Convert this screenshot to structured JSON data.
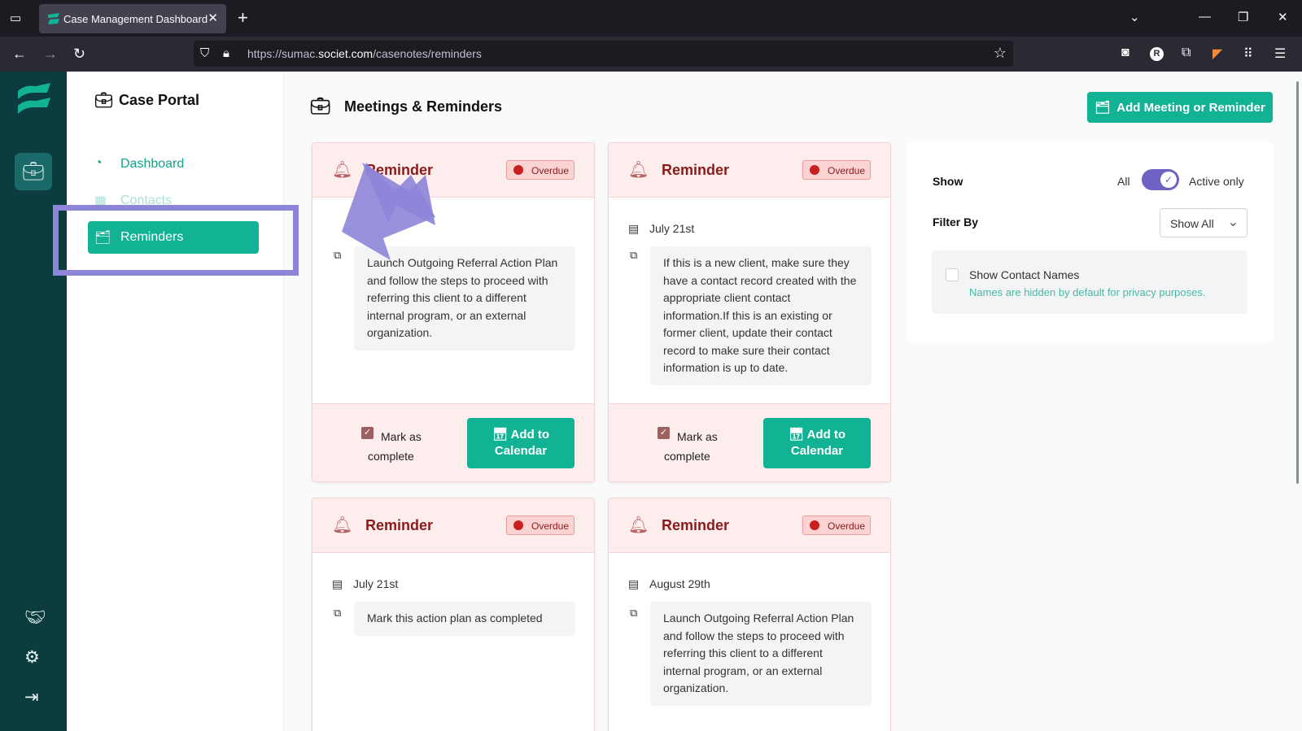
{
  "browser": {
    "tab_title": "Case Management Dashboard",
    "url_prefix": "https://sumac.",
    "url_domain": "societ.com",
    "url_path": "/casenotes/reminders",
    "profile_initial": "R"
  },
  "sidebar": {
    "brand": "Case Portal",
    "items": [
      {
        "label": "Dashboard",
        "icon": "dashboard-icon"
      },
      {
        "label": "Contacts",
        "icon": "contacts-icon"
      },
      {
        "label": "Reminders",
        "icon": "reminders-icon"
      }
    ]
  },
  "header": {
    "title": "Meetings & Reminders",
    "add_button": "Add Meeting or Reminder"
  },
  "cards": [
    {
      "title": "Reminder",
      "status": "Overdue",
      "date": "",
      "note": "Launch Outgoing Referral Action Plan and follow the steps to proceed with referring this client to a different internal program, or an external organization.",
      "mark_label": "Mark as complete",
      "calendar_label": "Add to Calendar"
    },
    {
      "title": "Reminder",
      "status": "Overdue",
      "date": "July 21st",
      "note": "If this is a new client, make sure they have a contact record created with the appropriate client contact information.If this is an existing or former client, update their contact record to make sure their contact information is up to date.",
      "mark_label": "Mark as complete",
      "calendar_label": "Add to Calendar"
    },
    {
      "title": "Reminder",
      "status": "Overdue",
      "date": "July 21st",
      "note": "Mark this action plan as completed"
    },
    {
      "title": "Reminder",
      "status": "Overdue",
      "date": "August 29th",
      "note": "Launch Outgoing Referral Action Plan and follow the steps to proceed with referring this client to a different internal program, or an external organization."
    }
  ],
  "filters": {
    "show_label": "Show",
    "all_label": "All",
    "active_only_label": "Active only",
    "active_only_on": true,
    "filter_by_label": "Filter By",
    "filter_by_value": "Show All",
    "show_contact_names_label": "Show Contact Names",
    "show_contact_names_hint": "Names are hidden by default for privacy purposes.",
    "show_contact_names_checked": false
  },
  "colors": {
    "primary": "#12b295",
    "rail": "#0c3c3f",
    "overdue": "#8b1b1b",
    "toggle": "#6c63c4",
    "annotation": "#8d85d8"
  }
}
